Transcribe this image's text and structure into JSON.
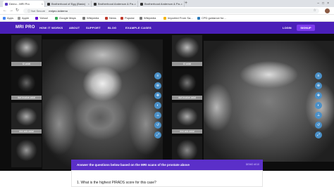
{
  "browser": {
    "tabs": [
      {
        "label": "Demo - MRI Pro",
        "active": true
      },
      {
        "label": "Brotherhood of Egg (Basic)",
        "active": false
      },
      {
        "label": "Brotherhood Anderson & Pa...",
        "active": false
      },
      {
        "label": "Brotherhood Anderson & Pa...",
        "active": false
      }
    ],
    "address_prefix": "Not Secure",
    "url": "mripro.io/demo",
    "bookmarks": [
      "Apps",
      "Apple",
      "Yahoo!",
      "Google Maps",
      "Wikipedia",
      "News",
      "Popular",
      "Wikipedia",
      "Imported From Sa...",
      "CPD guidance for..."
    ]
  },
  "header": {
    "logo": "MRI PRO",
    "nav": [
      "HOW IT WORKS",
      "ABOUT",
      "SUPPORT",
      "BLOG",
      "EXAMPLE CASES"
    ],
    "login": "LOGIN",
    "signup": "SIGNUP"
  },
  "viewer": {
    "left_thumbs": [
      "t2-axial",
      "dwi-bvalue-axial",
      "dwi-adc-axial",
      ""
    ],
    "right_thumbs": [
      "t2-axial",
      "dwi-bvalue-axial",
      "dwi-adc-axial",
      ""
    ],
    "tool_icons": [
      "layers-icon",
      "zoom-icon",
      "pan-icon",
      "contrast-icon",
      "ruler-icon",
      "reset-icon",
      "expand-icon"
    ]
  },
  "question_panel": {
    "title": "Answer the questions below based on the MRI scans of the prostate above",
    "demo_label": "DEMO #010",
    "question": "1.  What is the highest PIRADS score for this case?"
  },
  "colors": {
    "header_bg": "#4a1fb8",
    "signup_bg": "#7c3aed",
    "panel_bg": "#5b2fc9",
    "tool_bg": "#4a90c8"
  }
}
